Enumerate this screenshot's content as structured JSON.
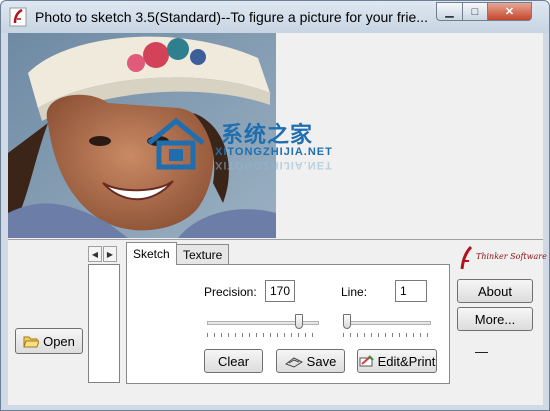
{
  "window": {
    "title": "Photo to sketch 3.5(Standard)--To figure a picture for your frie...",
    "minimize_glyph": "▁",
    "maximize_glyph": "□",
    "close_glyph": "✕"
  },
  "watermark": {
    "main": "系统之家",
    "sub": "XITONGZHIJIA.NET",
    "reflection": "XITONGZHIJIA.NET"
  },
  "left": {
    "open_label": "Open",
    "prev_arrow": "◀",
    "next_arrow": "▶"
  },
  "tabs": [
    {
      "label": "Sketch"
    },
    {
      "label": "Texture"
    }
  ],
  "sketch": {
    "precision_label": "Precision:",
    "precision_value": "170",
    "line_label": "Line:",
    "line_value": "1",
    "precision_slider_level": 0.85,
    "line_slider_level": 0.0,
    "clear_label": "Clear",
    "save_label": "Save",
    "editprint_label": "Edit&Print"
  },
  "right": {
    "logo_text": "Thinker Software",
    "about_label": "About",
    "more_label": "More...",
    "dash": "—"
  },
  "colors": {
    "titlebar": "#c7d4e2",
    "close_button": "#c5452b",
    "watermark": "#1f6fb0"
  }
}
